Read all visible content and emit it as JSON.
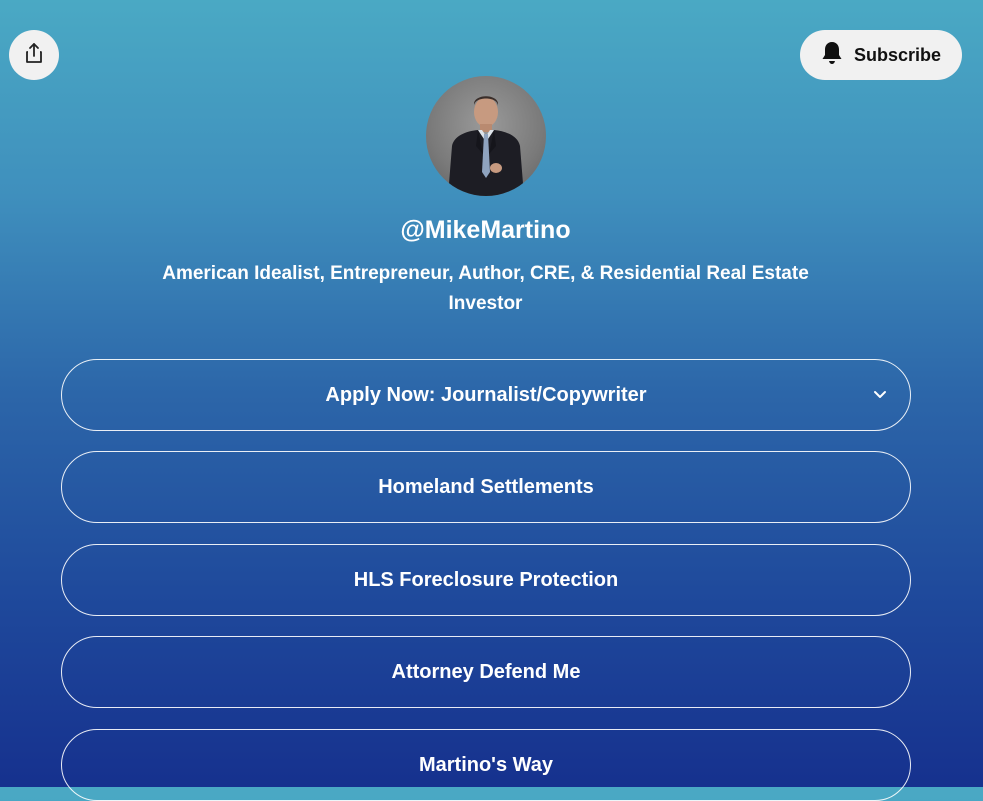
{
  "header": {
    "share_icon": "share-icon",
    "subscribe_label": "Subscribe",
    "subscribe_icon": "bell-icon"
  },
  "profile": {
    "name": "@MikeMartino",
    "bio": "American Idealist, Entrepreneur, Author, CRE, & Residential Real Estate Investor",
    "avatar_icon": "avatar-photo"
  },
  "links": [
    {
      "label": "Apply Now: Journalist/Copywriter",
      "has_dropdown": true
    },
    {
      "label": "Homeland Settlements"
    },
    {
      "label": "HLS Foreclosure Protection"
    },
    {
      "label": "Attorney Defend Me"
    },
    {
      "label": "Martino's Way"
    }
  ],
  "colors": {
    "gradient_top": "#4aa9c4",
    "gradient_bottom": "#16318e",
    "button_bg": "#f1f1f1",
    "link_border": "#ffffff"
  }
}
